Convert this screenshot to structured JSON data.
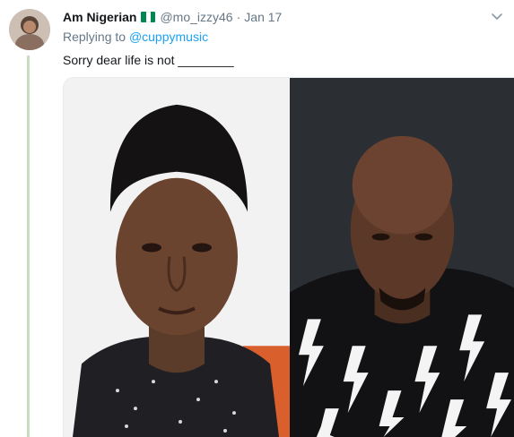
{
  "tweet": {
    "display_name": "Am Nigerian",
    "handle": "@mo_izzy46",
    "separator": "·",
    "timestamp": "Jan 17",
    "replying_prefix": "Replying to ",
    "replying_to": "@cuppymusic",
    "text": "Sorry dear life is not ________"
  },
  "icons": {
    "flag": "nigeria-flag-icon",
    "caret": "chevron-down-icon"
  },
  "colors": {
    "link": "#1da1f2",
    "secondary_text": "#657786",
    "flag_green": "#008751",
    "flag_white": "#ffffff"
  }
}
